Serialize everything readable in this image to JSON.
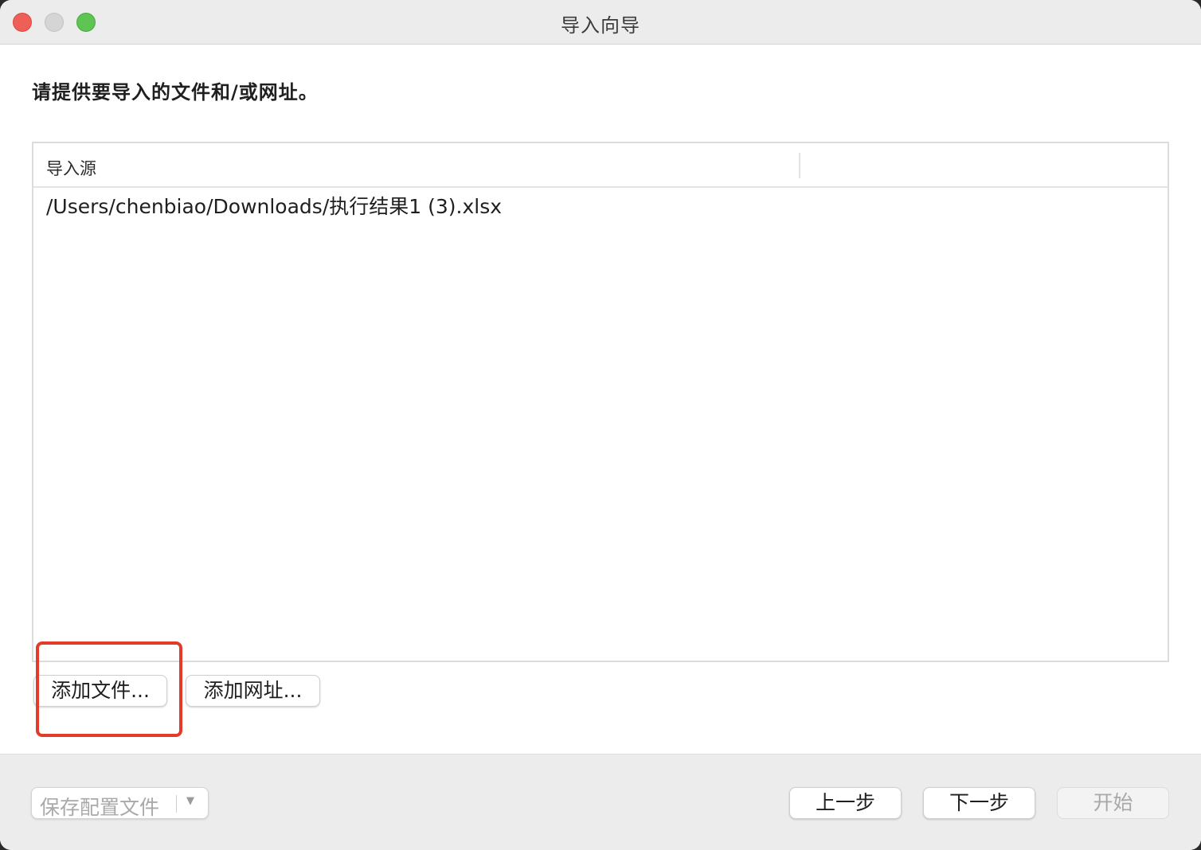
{
  "window": {
    "title": "导入向导"
  },
  "instruction": "请提供要导入的文件和/或网址。",
  "table": {
    "column_header": "导入源",
    "rows": [
      "/Users/chenbiao/Downloads/执行结果1 (3).xlsx"
    ]
  },
  "actions": {
    "add_file": "添加文件...",
    "add_url": "添加网址..."
  },
  "footer": {
    "save_profile": "保存配置文件",
    "save_profile_arrow": "▼",
    "prev": "上一步",
    "next": "下一步",
    "start": "开始"
  },
  "colors": {
    "highlight": "#e23b2c",
    "close": "#ee5f58",
    "minimize": "#d5d5d5",
    "maximize": "#5ec454"
  }
}
